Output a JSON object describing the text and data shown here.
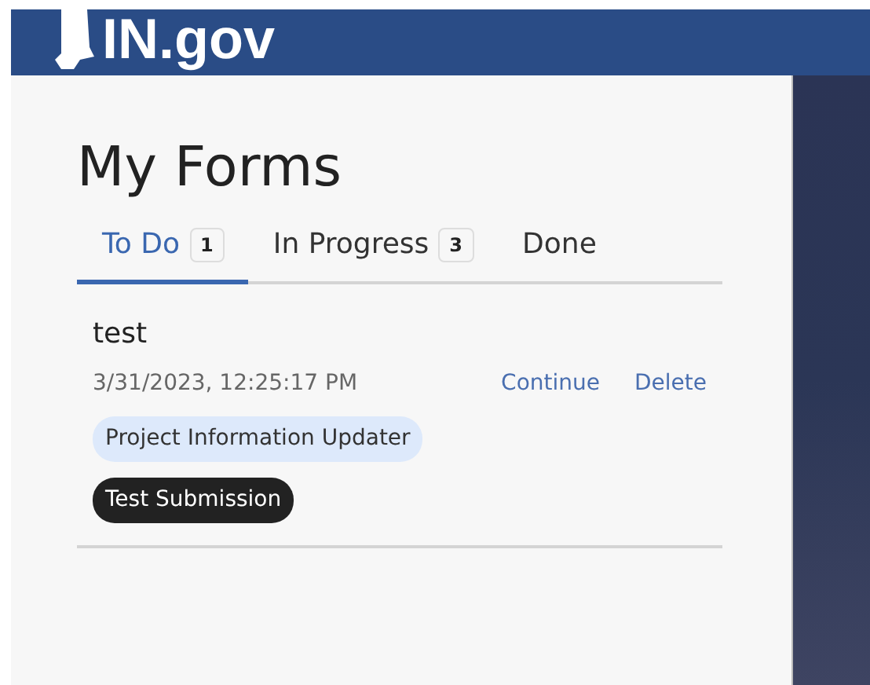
{
  "header": {
    "logo_text": "IN.gov"
  },
  "title": "My Forms",
  "tabs": [
    {
      "label": "To Do",
      "count": "1",
      "selected": true
    },
    {
      "label": "In Progress",
      "count": "3",
      "selected": false
    },
    {
      "label": "Done",
      "selected": false
    }
  ],
  "forms": [
    {
      "name": "test",
      "date": "3/31/2023, 12:25:17 PM",
      "actions": [
        "Continue",
        "Delete"
      ],
      "tags": [
        {
          "label": "Project Information Updater",
          "kind": "form"
        },
        {
          "label": "Test Submission",
          "kind": "status"
        }
      ]
    }
  ]
}
